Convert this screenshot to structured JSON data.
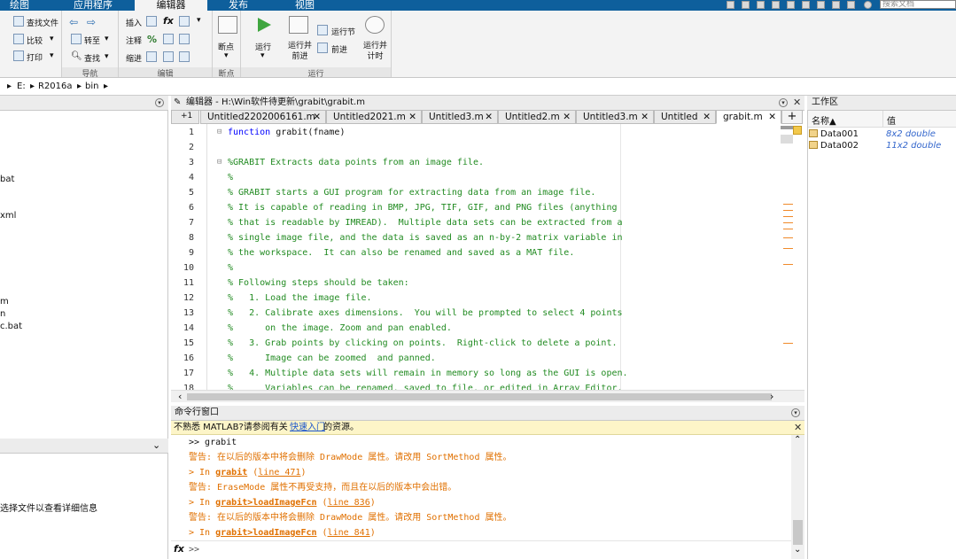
{
  "toolstrip": {
    "tabs": [
      "绘图",
      "应用程序",
      "编辑器",
      "发布",
      "视图"
    ],
    "active_tab": "编辑器",
    "search_placeholder": "搜索文档"
  },
  "ribbon": {
    "file_group": {
      "find_files": "查找文件",
      "compare": "比较",
      "print": "打印"
    },
    "navigate_group": {
      "goto": "转至",
      "find": "查找",
      "caption": "导航"
    },
    "edit_group": {
      "insert": "插入",
      "comment": "注释",
      "indent": "缩进",
      "fx": "fx",
      "caption": "编辑"
    },
    "breakpoint_group": {
      "breakpoints": "断点",
      "caption": "断点"
    },
    "run_group": {
      "run": "运行",
      "run_advance": "运行并\n前进",
      "run_section": "运行节",
      "advance": "前进",
      "run_time": "运行并\n计时",
      "caption": "运行"
    }
  },
  "address_bar": {
    "crumbs": [
      "E:",
      "R2016a",
      "bin"
    ]
  },
  "current_folder": {
    "files": [
      "bat",
      "xml",
      "m",
      "n",
      "c.bat"
    ],
    "details_hint": "选择文件以查看详细信息"
  },
  "editor": {
    "title": "编辑器 - H:\\Win软件待更新\\grabit\\grabit.m",
    "tabs": [
      "Untitled2202006161.m",
      "Untitled2021.m",
      "Untitled3.m",
      "Untitled2.m",
      "Untitled3.m",
      "Untitled",
      "grabit.m"
    ],
    "active_tab": "grabit.m",
    "tab_count_label": "+1",
    "lines": [
      {
        "n": "1",
        "text": "function grabit(fname)"
      },
      {
        "n": "2",
        "text": ""
      },
      {
        "n": "3",
        "text": "%GRABIT Extracts data points from an image file."
      },
      {
        "n": "4",
        "text": "%"
      },
      {
        "n": "5",
        "text": "% GRABIT starts a GUI program for extracting data from an image file."
      },
      {
        "n": "6",
        "text": "% It is capable of reading in BMP, JPG, TIF, GIF, and PNG files (anything"
      },
      {
        "n": "7",
        "text": "% that is readable by IMREAD).  Multiple data sets can be extracted from a"
      },
      {
        "n": "8",
        "text": "% single image file, and the data is saved as an n-by-2 matrix variable in"
      },
      {
        "n": "9",
        "text": "% the workspace.  It can also be renamed and saved as a MAT file."
      },
      {
        "n": "10",
        "text": "%"
      },
      {
        "n": "11",
        "text": "% Following steps should be taken:"
      },
      {
        "n": "12",
        "text": "%   1. Load the image file."
      },
      {
        "n": "13",
        "text": "%   2. Calibrate axes dimensions.  You will be prompted to select 4 points"
      },
      {
        "n": "14",
        "text": "%      on the image. Zoom and pan enabled."
      },
      {
        "n": "15",
        "text": "%   3. Grab points by clicking on points.  Right-click to delete a point."
      },
      {
        "n": "16",
        "text": "%      Image can be zoomed  and panned."
      },
      {
        "n": "17",
        "text": "%   4. Multiple data sets will remain in memory so long as the GUI is open."
      },
      {
        "n": "18",
        "text": "%      Variables can be renamed, saved to file, or edited in Array Editor."
      }
    ]
  },
  "command_window": {
    "title": "命令行窗口",
    "notice_prefix": "不熟悉 MATLAB?请参阅有关",
    "notice_link": "快速入门",
    "notice_suffix": "的资源。",
    "lines": {
      "l1": ">> grabit",
      "l2": "警告: 在以后的版本中将会删除 DrawMode 属性。请改用 SortMethod 属性。",
      "l3_pre": "> In ",
      "l3_fn": "grabit",
      "l3_ln": "line 471",
      "l4": "警告: EraseMode 属性不再受支持，而且在以后的版本中会出错。",
      "l5_pre": "> In ",
      "l5_fn": "grabit>loadImageFcn",
      "l5_ln": "line 836",
      "l6": "警告: 在以后的版本中将会删除 DrawMode 属性。请改用 SortMethod 属性。",
      "l7_pre": "> In ",
      "l7_fn": "grabit>loadImageFcn",
      "l7_ln": "line 841",
      "prompt": ">>",
      "fx": "fx"
    }
  },
  "workspace": {
    "title": "工作区",
    "col_name": "名称▲",
    "col_value": "值",
    "vars": [
      {
        "name": "Data001",
        "value": "8x2 double"
      },
      {
        "name": "Data002",
        "value": "11x2 double"
      }
    ]
  }
}
